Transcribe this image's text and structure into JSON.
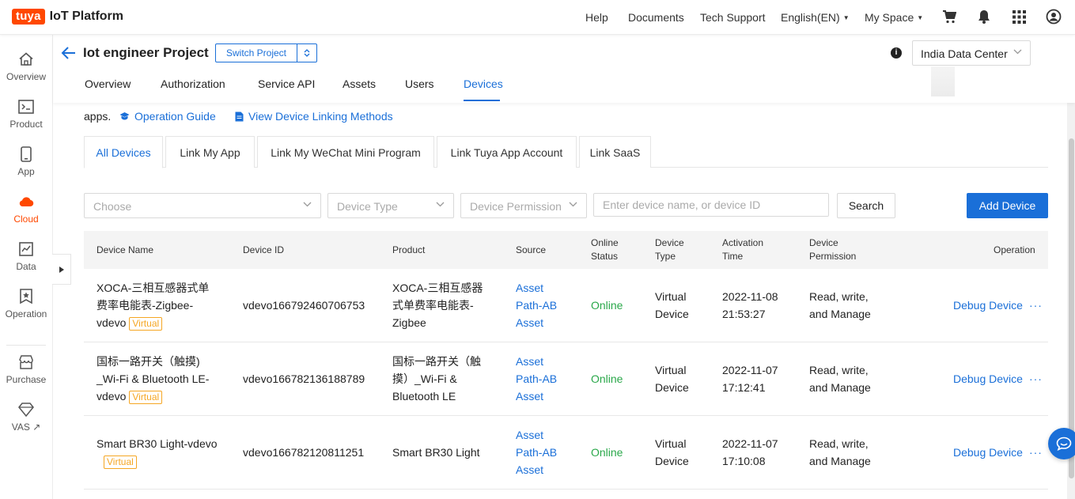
{
  "brand": {
    "logo_badge": "tuya",
    "logo_text": "IoT Platform"
  },
  "topnav": {
    "help": "Help",
    "documents": "Documents",
    "tech_support": "Tech Support",
    "language": "English(EN)",
    "my_space": "My Space",
    "icons": [
      "cart-icon",
      "bell-icon",
      "apps-grid-icon",
      "user-icon"
    ]
  },
  "sidebar": {
    "items": [
      {
        "label": "Overview",
        "icon": "home-icon"
      },
      {
        "label": "Product",
        "icon": "terminal-icon"
      },
      {
        "label": "App",
        "icon": "phone-icon"
      },
      {
        "label": "Cloud",
        "icon": "cloud-icon"
      },
      {
        "label": "Data",
        "icon": "chart-icon"
      },
      {
        "label": "Operation",
        "icon": "badge-icon"
      },
      {
        "label": "Purchase",
        "icon": "store-icon"
      },
      {
        "label": "VAS ↗",
        "icon": "diamond-icon"
      }
    ],
    "active": "Cloud"
  },
  "project": {
    "title": "Iot engineer Project",
    "switch_label": "Switch Project",
    "data_center": "India Data Center"
  },
  "nav_tabs": [
    "Overview",
    "Authorization",
    "Service API",
    "Assets",
    "Users",
    "Devices"
  ],
  "active_nav_tab": "Devices",
  "intro": {
    "apps_text": "apps.",
    "operation_guide": "Operation Guide",
    "view_linking": "View Device Linking Methods"
  },
  "sub_tabs": [
    "All Devices",
    "Link My App",
    "Link My WeChat Mini Program",
    "Link Tuya App Account",
    "Link SaaS"
  ],
  "active_sub_tab": "All Devices",
  "filters": {
    "choose_placeholder": "Choose",
    "device_type_placeholder": "Device Type",
    "device_permission_placeholder": "Device Permission",
    "search_placeholder": "Enter device name, or device ID",
    "search_button": "Search",
    "add_device_button": "Add Device"
  },
  "table": {
    "headers": {
      "device_name": "Device Name",
      "device_id": "Device ID",
      "product": "Product",
      "source": "Source",
      "online_status_1": "Online",
      "online_status_2": "Status",
      "device_type_1": "Device",
      "device_type_2": "Type",
      "activation_1": "Activation",
      "activation_2": "Time",
      "permission_1": "Device",
      "permission_2": "Permission",
      "operation": "Operation"
    },
    "rows": [
      {
        "name_lines": [
          "XOCA-三相互感器式单",
          "费率电能表-Zigbee-",
          "vdevo"
        ],
        "tag": "Virtual",
        "device_id": "vdevo166792460706753",
        "product_lines": [
          "XOCA-三相互感器",
          "式单费率电能表-",
          "Zigbee"
        ],
        "source_lines": [
          "Asset",
          "Path-AB",
          "Asset"
        ],
        "status": "Online",
        "type_lines": [
          "Virtual",
          "Device"
        ],
        "time_lines": [
          "2022-11-08",
          "21:53:27"
        ],
        "permission_lines": [
          "Read, write,",
          "and Manage"
        ],
        "operation": "Debug Device",
        "more": "···"
      },
      {
        "name_lines": [
          "国标一路开关（触摸)",
          "_Wi-Fi & Bluetooth LE-",
          "vdevo"
        ],
        "tag": "Virtual",
        "device_id": "vdevo166782136188789",
        "product_lines": [
          "国标一路开关（触",
          "摸）_Wi-Fi &",
          "Bluetooth LE"
        ],
        "source_lines": [
          "Asset",
          "Path-AB",
          "Asset"
        ],
        "status": "Online",
        "type_lines": [
          "Virtual",
          "Device"
        ],
        "time_lines": [
          "2022-11-07",
          "17:12:41"
        ],
        "permission_lines": [
          "Read, write,",
          "and Manage"
        ],
        "operation": "Debug Device",
        "more": "···"
      },
      {
        "name_lines": [
          "Smart BR30 Light-vdevo"
        ],
        "tag": "Virtual",
        "device_id": "vdevo166782120811251",
        "product_lines": [
          "Smart BR30 Light"
        ],
        "source_lines": [
          "Asset",
          "Path-AB",
          "Asset"
        ],
        "status": "Online",
        "type_lines": [
          "Virtual",
          "Device"
        ],
        "time_lines": [
          "2022-11-07",
          "17:10:08"
        ],
        "permission_lines": [
          "Read, write,",
          "and Manage"
        ],
        "operation": "Debug Device",
        "more": "···"
      }
    ]
  },
  "colors": {
    "accent": "#1a6fd8",
    "brand": "#ff4800",
    "online": "#2aa84a",
    "virtual_tag": "#f5a623"
  }
}
